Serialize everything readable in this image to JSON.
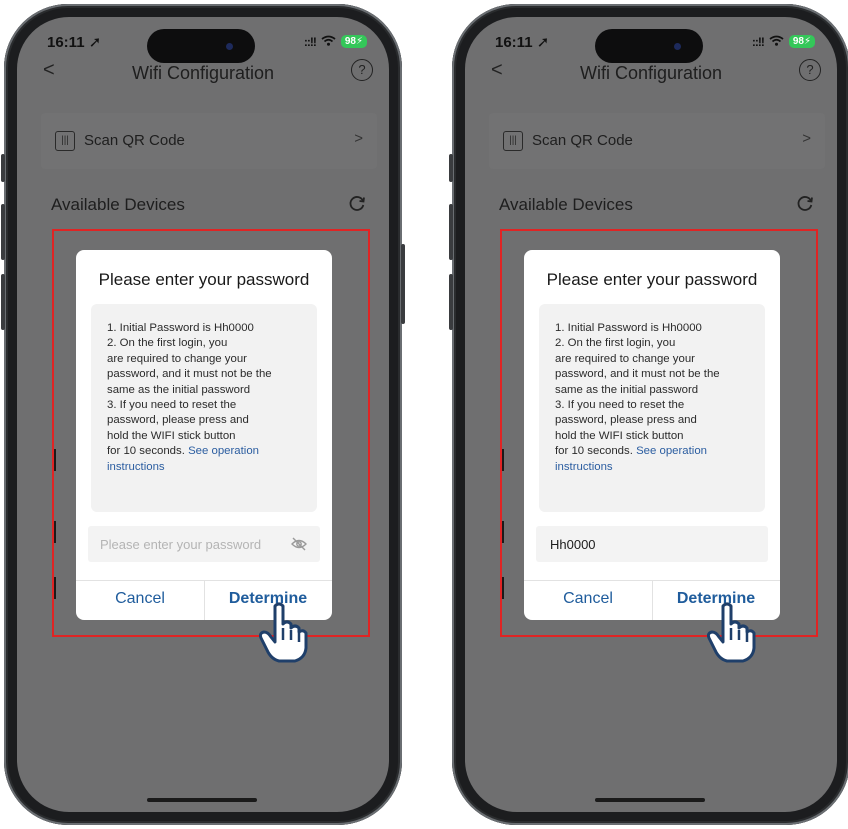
{
  "left": {
    "status": {
      "time": "16:11 ➚",
      "signal": "::!!",
      "battery": "98⚡"
    },
    "nav": {
      "back": "<",
      "title": "Wifi Configuration",
      "help": "?"
    },
    "scan": {
      "label": "Scan QR Code",
      "chevron": ">"
    },
    "devices": {
      "title": "Available Devices"
    },
    "dialog": {
      "title": "Please enter your password",
      "lines": [
        "1. Initial Password is Hh0000",
        "2. On the first login, you",
        "are required to change your",
        "password, and it must not be the",
        "same as the initial password",
        "3. If you need to reset the",
        "password, please press and",
        "hold the WIFI stick button"
      ],
      "last_line_prefix": "for 10 seconds. ",
      "link_part1": "See operation",
      "link_part2": "instructions",
      "password_placeholder": "Please enter your password",
      "password_value": "",
      "cancel": "Cancel",
      "determine": "Determine"
    }
  },
  "right": {
    "status": {
      "time": "16:11 ➚",
      "signal": "::!!",
      "battery": "98⚡"
    },
    "nav": {
      "back": "<",
      "title": "Wifi Configuration",
      "help": "?"
    },
    "scan": {
      "label": "Scan QR Code",
      "chevron": ">"
    },
    "devices": {
      "title": "Available Devices"
    },
    "dialog": {
      "title": "Please enter your password",
      "lines": [
        "1. Initial Password is Hh0000",
        "2. On the first login, you",
        "are required to change your",
        "password, and it must not be the",
        "same as the initial password",
        "3. If you need to reset the",
        "password, please press and",
        "hold the WIFI stick button"
      ],
      "last_line_prefix": "for 10 seconds. ",
      "link_part1": "See operation",
      "link_part2": "instructions",
      "password_placeholder": "",
      "password_value": "Hh0000",
      "cancel": "Cancel",
      "determine": "Determine"
    }
  },
  "colors": {
    "highlight_box": "#e02424",
    "link": "#2b5da0",
    "button_text": "#1f5c9c",
    "battery": "#34c759"
  },
  "icons": [
    "back-chevron-icon",
    "help-icon",
    "qr-scan-icon",
    "chevron-right-icon",
    "refresh-icon",
    "eye-off-icon",
    "pointing-hand-icon"
  ]
}
